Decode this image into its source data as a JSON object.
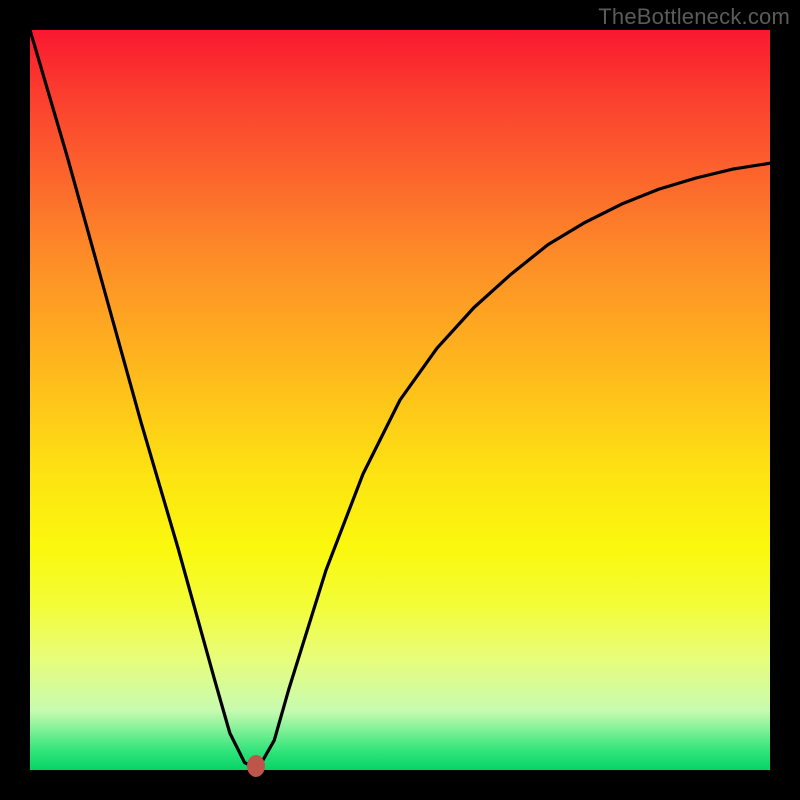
{
  "attribution": "TheBottleneck.com",
  "chart_data": {
    "type": "line",
    "title": "",
    "xlabel": "",
    "ylabel": "",
    "xlim": [
      0,
      100
    ],
    "ylim": [
      0,
      100
    ],
    "series": [
      {
        "name": "bottleneck-curve",
        "x": [
          0,
          5,
          10,
          15,
          20,
          25,
          27,
          29,
          30,
          31,
          33,
          35,
          40,
          45,
          50,
          55,
          60,
          65,
          70,
          75,
          80,
          85,
          90,
          95,
          100
        ],
        "values": [
          100,
          83,
          65,
          47,
          30,
          12,
          5,
          1,
          0.5,
          0.5,
          4,
          11,
          27,
          40,
          50,
          57,
          62.5,
          67,
          71,
          74,
          76.5,
          78.5,
          80,
          81.2,
          82
        ]
      }
    ],
    "marker": {
      "x": 30.5,
      "y": 0.5,
      "color": "#bd554a"
    },
    "background_gradient": {
      "stops": [
        {
          "pos": 0.0,
          "color": "#f91830"
        },
        {
          "pos": 0.3,
          "color": "#fd8a28"
        },
        {
          "pos": 0.6,
          "color": "#fde312"
        },
        {
          "pos": 0.85,
          "color": "#e8fd7b"
        },
        {
          "pos": 1.0,
          "color": "#06d466"
        }
      ]
    }
  }
}
